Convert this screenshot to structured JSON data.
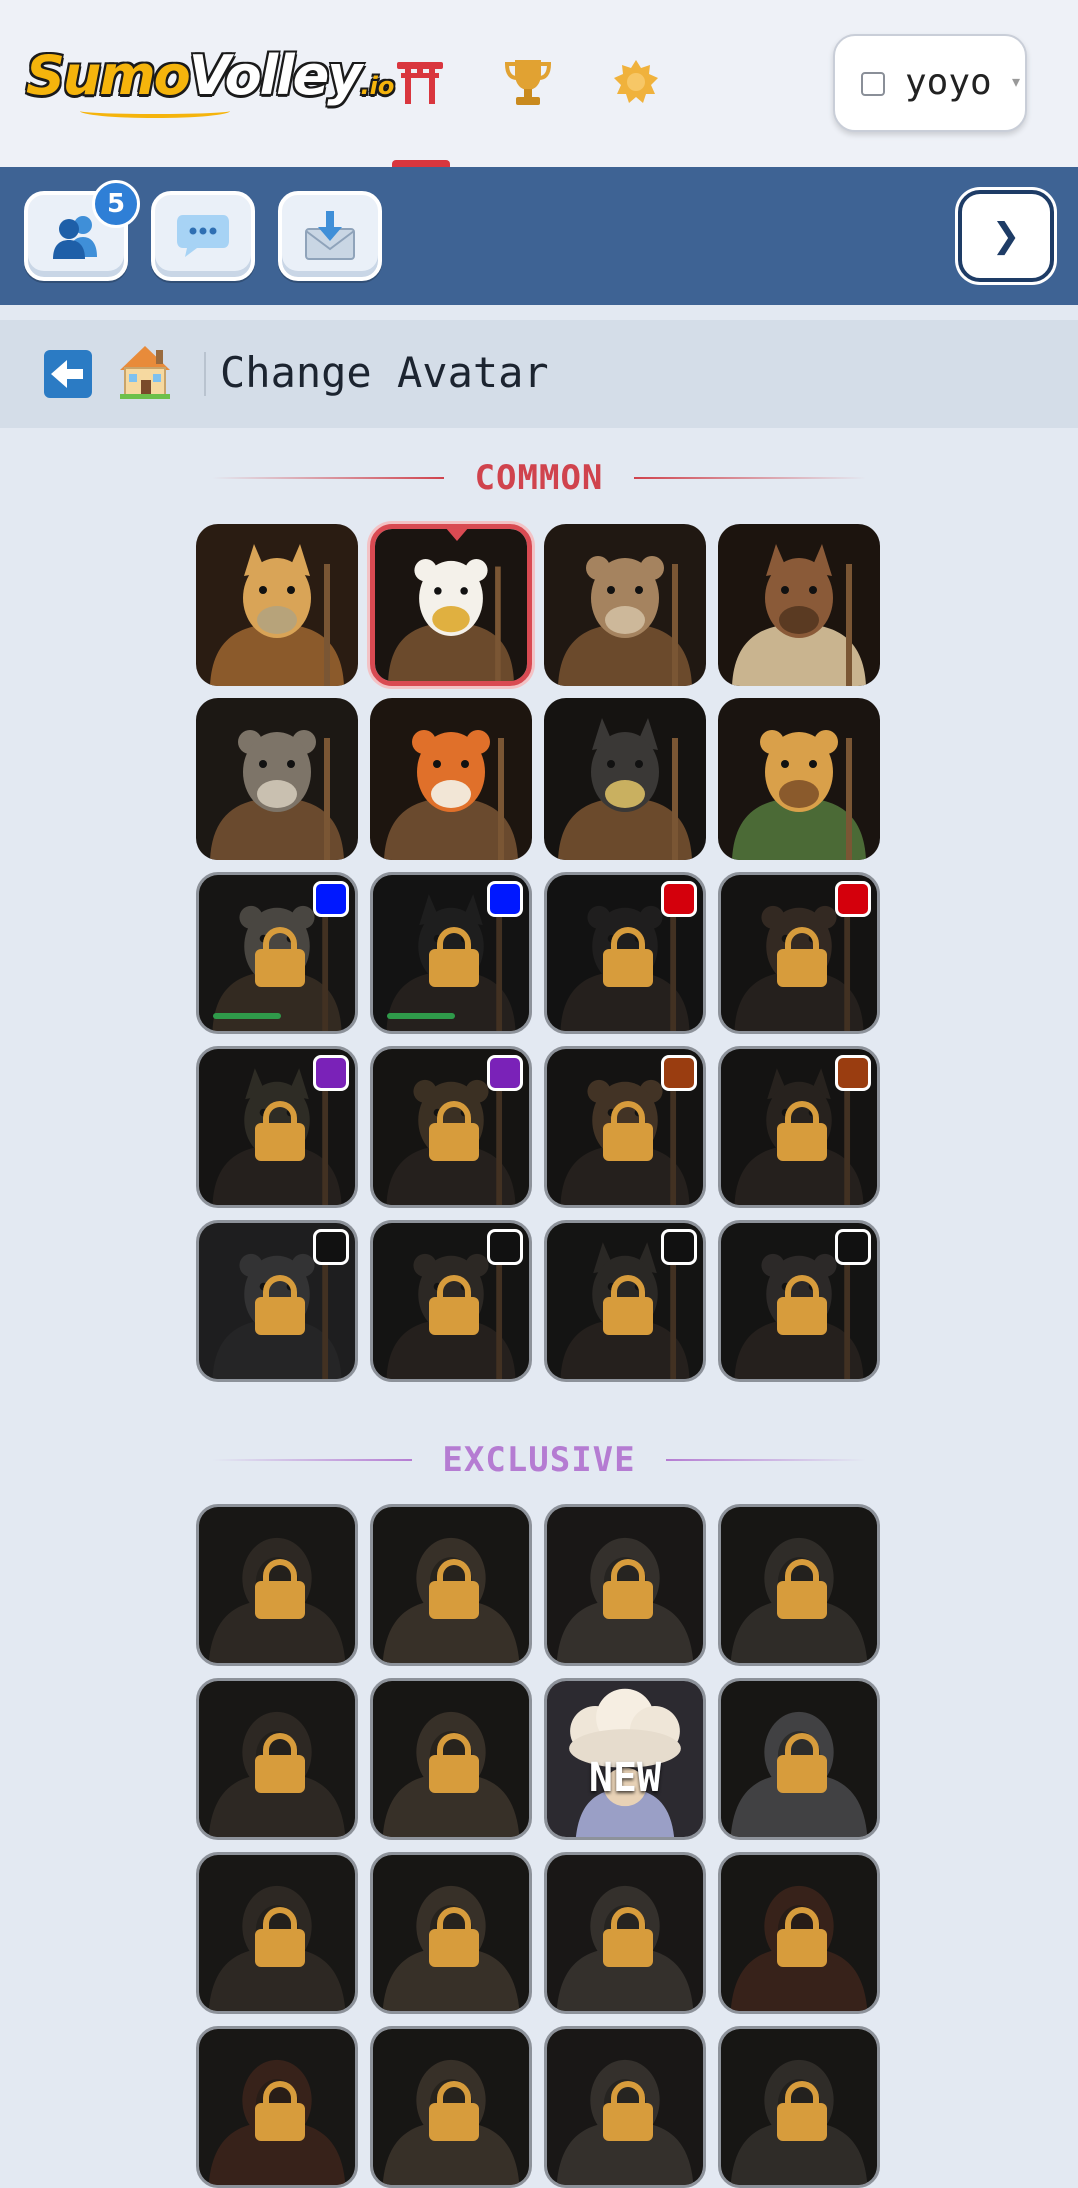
{
  "header": {
    "logo": {
      "part1": "Sumo",
      "part2": "Volley",
      "suffix": ".io"
    },
    "nav": [
      {
        "icon": "torii-gate-icon",
        "color": "#d9363e",
        "active": true
      },
      {
        "icon": "trophy-icon",
        "color": "#e1a232",
        "active": false
      },
      {
        "icon": "badge-star-icon",
        "color": "#f0b23c",
        "active": false
      }
    ],
    "user": {
      "name": "yoyo",
      "caret": "▾"
    }
  },
  "toolbar": {
    "friends_badge": "5",
    "next_glyph": "❯",
    "buttons": [
      "friends-icon",
      "chat-icon",
      "inbox-icon"
    ]
  },
  "breadcrumb": {
    "title": "Change Avatar"
  },
  "sections": {
    "common": {
      "title": "COMMON",
      "color": "#d0434d"
    },
    "exclusive": {
      "title": "EXCLUSIVE",
      "color": "#b57cd2"
    }
  },
  "common_avatars": [
    {
      "animal": "giraffe",
      "locked": false,
      "selected": false,
      "rarity": null
    },
    {
      "animal": "eagle",
      "locked": false,
      "selected": true,
      "rarity": null
    },
    {
      "animal": "falcon",
      "locked": false,
      "selected": false,
      "rarity": null
    },
    {
      "animal": "horse",
      "locked": false,
      "selected": false,
      "rarity": null
    },
    {
      "animal": "wolf",
      "locked": false,
      "selected": false,
      "rarity": null
    },
    {
      "animal": "fox",
      "locked": false,
      "selected": false,
      "rarity": null
    },
    {
      "animal": "panther",
      "locked": false,
      "selected": false,
      "rarity": null
    },
    {
      "animal": "leopard",
      "locked": false,
      "selected": false,
      "rarity": null
    },
    {
      "animal": "owl",
      "locked": true,
      "rarity": "#0018ff",
      "progress": 0.45
    },
    {
      "animal": "crow",
      "locked": true,
      "rarity": "#0018ff",
      "progress": 0.45
    },
    {
      "animal": "gorilla",
      "locked": true,
      "rarity": "#d4000c",
      "progress": null
    },
    {
      "animal": "bear",
      "locked": true,
      "rarity": "#d4000c",
      "progress": null
    },
    {
      "animal": "turtle",
      "locked": true,
      "rarity": "#7a22b8",
      "progress": null
    },
    {
      "animal": "lion",
      "locked": true,
      "rarity": "#7a22b8",
      "progress": null
    },
    {
      "animal": "tiger",
      "locked": true,
      "rarity": "#9a3d10",
      "progress": null
    },
    {
      "animal": "bison",
      "locked": true,
      "rarity": "#9a3d10",
      "progress": null
    },
    {
      "animal": "polar-bear",
      "locked": true,
      "rarity": "#111111",
      "progress": null
    },
    {
      "animal": "goat",
      "locked": true,
      "rarity": "#111111",
      "progress": null
    },
    {
      "animal": "rhino",
      "locked": true,
      "rarity": "#111111",
      "progress": null
    },
    {
      "animal": "elephant",
      "locked": true,
      "rarity": "#111111",
      "progress": null
    }
  ],
  "exclusive_avatars": [
    {
      "animal": "treant",
      "locked": true
    },
    {
      "animal": "pot-creature",
      "locked": true
    },
    {
      "animal": "armored-golem",
      "locked": true
    },
    {
      "animal": "armored-knight",
      "locked": true
    },
    {
      "animal": "crystal-mage",
      "locked": true
    },
    {
      "animal": "rock-golem",
      "locked": true
    },
    {
      "animal": "cloud-spirit",
      "locked": false,
      "new_label": "NEW"
    },
    {
      "animal": "hooded-ghost",
      "locked": true
    },
    {
      "animal": "plant-druid",
      "locked": true
    },
    {
      "animal": "willow-spirit",
      "locked": true
    },
    {
      "animal": "hooded-rogue",
      "locked": true
    },
    {
      "animal": "fire-demon",
      "locked": true
    },
    {
      "animal": "flame-spirit",
      "locked": true
    },
    {
      "animal": "coral-spirit",
      "locked": true
    },
    {
      "animal": "stone-elder",
      "locked": true
    },
    {
      "animal": "shadow-beast",
      "locked": true
    }
  ]
}
